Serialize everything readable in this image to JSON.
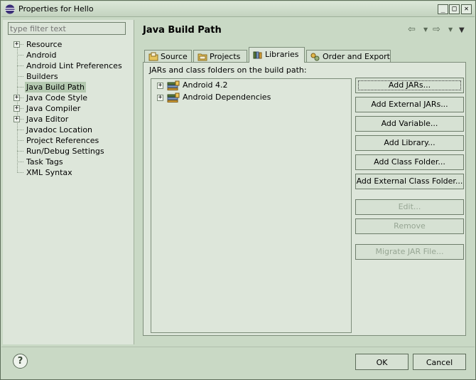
{
  "window": {
    "title": "Properties for Hello"
  },
  "filter": {
    "placeholder": "type filter text"
  },
  "nav_tree": [
    {
      "label": "Resource",
      "expandable": true
    },
    {
      "label": "Android",
      "expandable": false
    },
    {
      "label": "Android Lint Preferences",
      "expandable": false
    },
    {
      "label": "Builders",
      "expandable": false
    },
    {
      "label": "Java Build Path",
      "expandable": false,
      "selected": true
    },
    {
      "label": "Java Code Style",
      "expandable": true
    },
    {
      "label": "Java Compiler",
      "expandable": true
    },
    {
      "label": "Java Editor",
      "expandable": true
    },
    {
      "label": "Javadoc Location",
      "expandable": false
    },
    {
      "label": "Project References",
      "expandable": false
    },
    {
      "label": "Run/Debug Settings",
      "expandable": false
    },
    {
      "label": "Task Tags",
      "expandable": false
    },
    {
      "label": "XML Syntax",
      "expandable": false
    }
  ],
  "page": {
    "title": "Java Build Path"
  },
  "tabs": [
    {
      "label": "Source"
    },
    {
      "label": "Projects"
    },
    {
      "label": "Libraries",
      "active": true
    },
    {
      "label": "Order and Export"
    }
  ],
  "libraries": {
    "label": "JARs and class folders on the build path:",
    "items": [
      "Android 4.2",
      "Android Dependencies"
    ]
  },
  "buttons": {
    "add_jars": "Add JARs...",
    "add_external_jars": "Add External JARs...",
    "add_variable": "Add Variable...",
    "add_library": "Add Library...",
    "add_class_folder": "Add Class Folder...",
    "add_external_class_folder": "Add External Class Folder...",
    "edit": "Edit...",
    "remove": "Remove",
    "migrate_jar": "Migrate JAR File..."
  },
  "footer": {
    "ok": "OK",
    "cancel": "Cancel",
    "help": "?"
  },
  "colors": {
    "background": "#c9d9c5",
    "panel": "#dde6da",
    "selection": "#b3c8af"
  }
}
